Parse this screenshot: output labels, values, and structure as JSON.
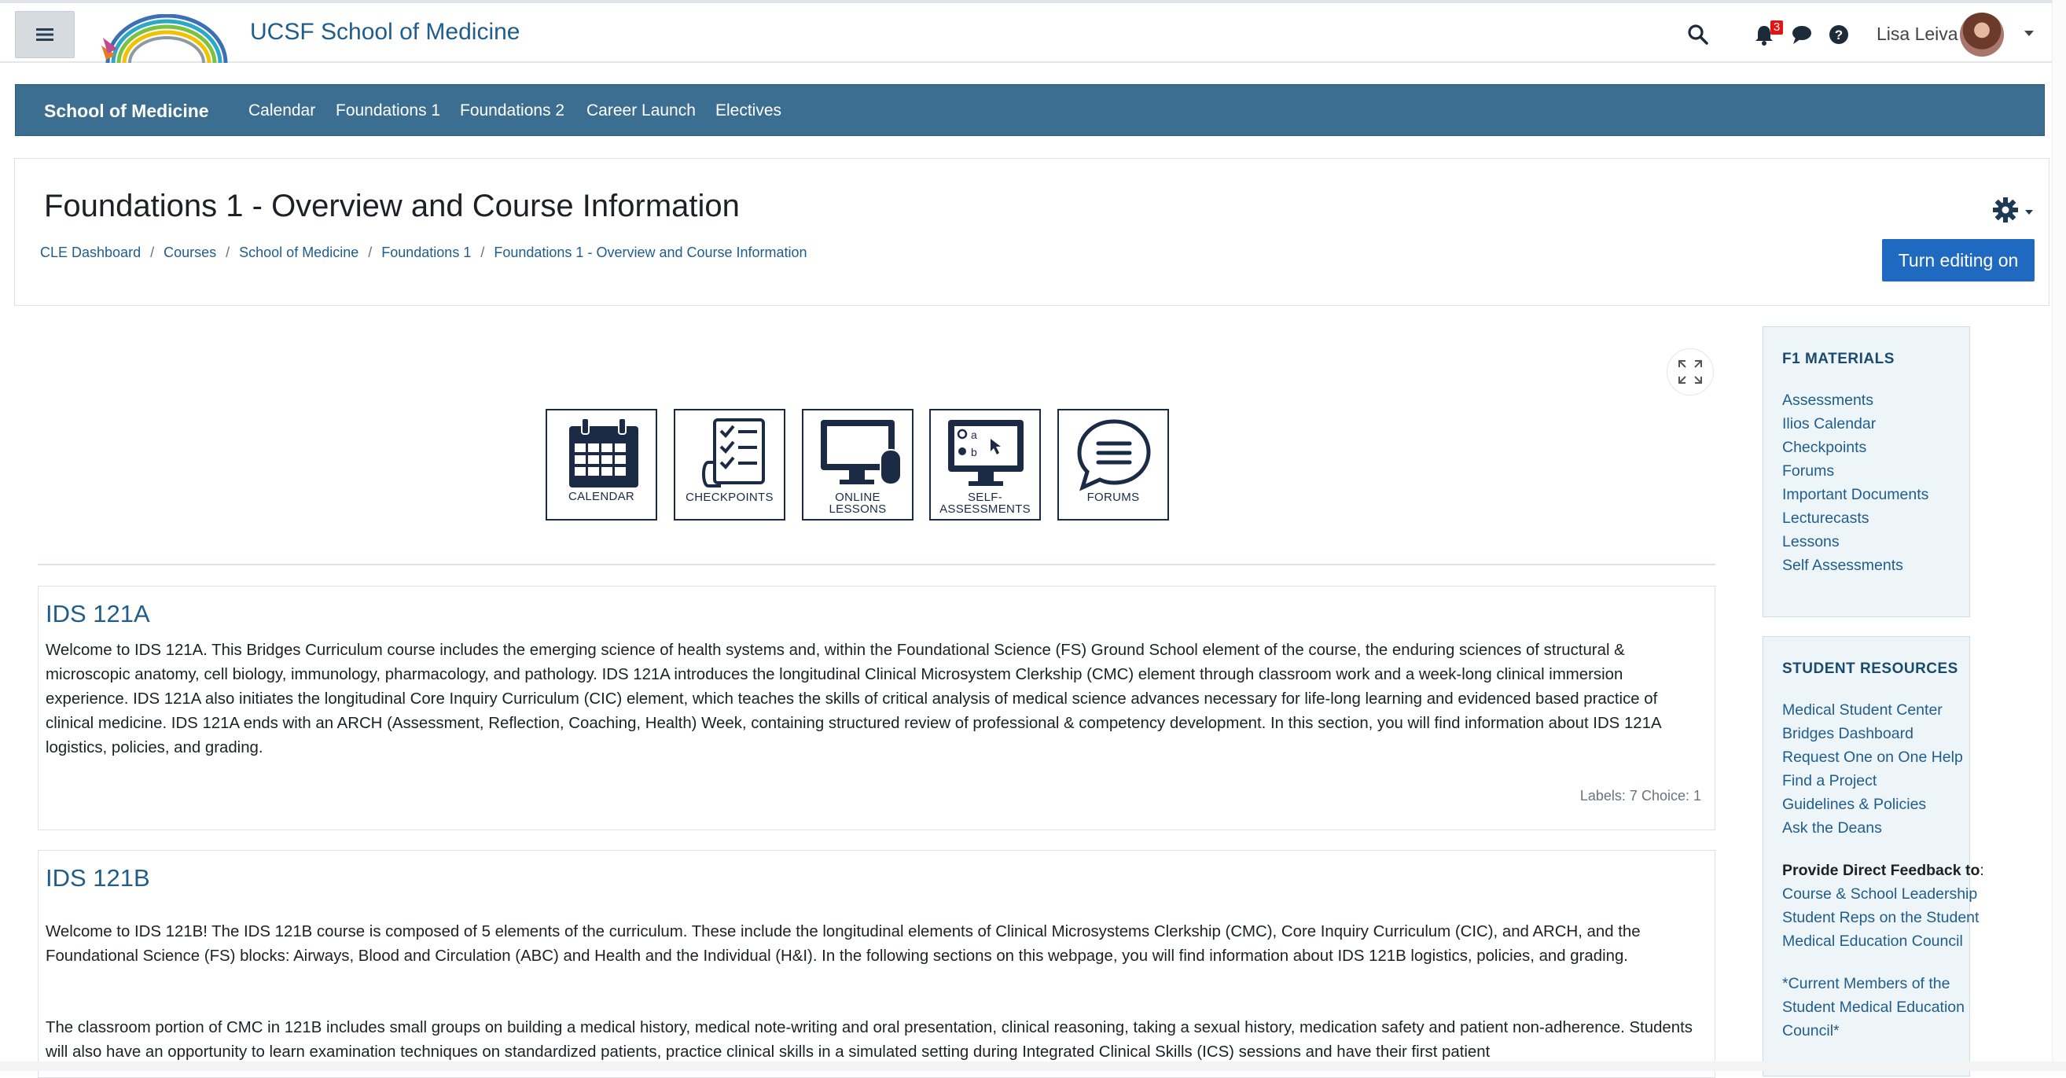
{
  "topbar": {
    "site_title": "UCSF School of Medicine",
    "notification_count": "3",
    "user_name": "Lisa Leiva"
  },
  "coursebar": {
    "brand": "School of Medicine",
    "items": [
      "Calendar",
      "Foundations 1",
      "Foundations 2",
      "Career Launch",
      "Electives"
    ]
  },
  "header": {
    "title": "Foundations 1 - Overview and Course Information",
    "breadcrumb": [
      "CLE Dashboard",
      "Courses",
      "School of Medicine",
      "Foundations 1",
      "Foundations 1 - Overview and Course Information"
    ],
    "edit_button": "Turn editing on"
  },
  "tiles": [
    {
      "label1": "CALENDAR",
      "label2": ""
    },
    {
      "label1": "CHECKPOINTS",
      "label2": ""
    },
    {
      "label1": "ONLINE",
      "label2": "LESSONS"
    },
    {
      "label1": "SELF-",
      "label2": "ASSESSMENTS"
    },
    {
      "label1": "FORUMS",
      "label2": ""
    }
  ],
  "sections": [
    {
      "title": "IDS 121A",
      "body": "Welcome to IDS 121A. This Bridges Curriculum course includes the emerging science of health systems and, within the Foundational Science (FS) Ground School element of the course, the enduring sciences of structural & microscopic anatomy, cell biology, immunology, pharmacology, and pathology. IDS 121A introduces the longitudinal Clinical Microsystem Clerkship (CMC) element through classroom work and a week-long clinical immersion experience. IDS 121A also initiates the longitudinal Core Inquiry Curriculum (CIC) element, which teaches the skills of critical analysis of medical science advances necessary for life-long learning and evidenced based practice of clinical medicine. IDS 121A ends with an ARCH (Assessment, Reflection, Coaching, Health) Week, containing structured review of professional & competency development. In this section, you will find information about IDS 121A logistics, policies, and grading.",
      "counts": "Labels: 7  Choice: 1"
    },
    {
      "title": "IDS 121B",
      "body": "Welcome to IDS 121B!  The IDS 121B course is composed of 5 elements of the curriculum. These include the longitudinal elements of Clinical Microsystems Clerkship (CMC), Core Inquiry Curriculum (CIC), and ARCH, and the Foundational Science (FS) blocks: Airways, Blood and Circulation (ABC) and Health and the Individual (H&I).  In the following sections on this webpage, you will find information about IDS 121B logistics, policies, and grading.",
      "body2": "The classroom portion of CMC in 121B includes small groups on building a medical history, medical note-writing and oral presentation, clinical reasoning, taking a sexual history, medication safety and patient non-adherence.  Students will also have an opportunity to learn examination techniques on standardized patients, practice clinical skills in a simulated setting during Integrated Clinical Skills (ICS) sessions and have their first patient"
    }
  ],
  "f1_materials": {
    "title": "F1 MATERIALS",
    "links": [
      "Assessments",
      "Ilios Calendar",
      "Checkpoints",
      "Forums",
      "Important Documents",
      "Lecturecasts",
      "Lessons",
      "Self Assessments"
    ]
  },
  "student_resources": {
    "title": "STUDENT RESOURCES",
    "links": [
      "Medical Student Center",
      "Bridges Dashboard",
      "Request One on One Help",
      "Find a Project",
      "Guidelines & Policies",
      "Ask the Deans"
    ],
    "feedback_heading": "Provide Direct Feedback to",
    "feedback_colon": ":",
    "feedback_links": [
      "Course & School Leadership",
      "Student Reps on the Student",
      "Medical Education Council"
    ],
    "current_members": [
      "*Current Members of the",
      "Student Medical Education",
      "Council*"
    ]
  },
  "colors": {
    "coursebar": "#3c6e91",
    "link": "#1f5d8c",
    "button": "#1f6ac0",
    "badge": "#e31414"
  }
}
